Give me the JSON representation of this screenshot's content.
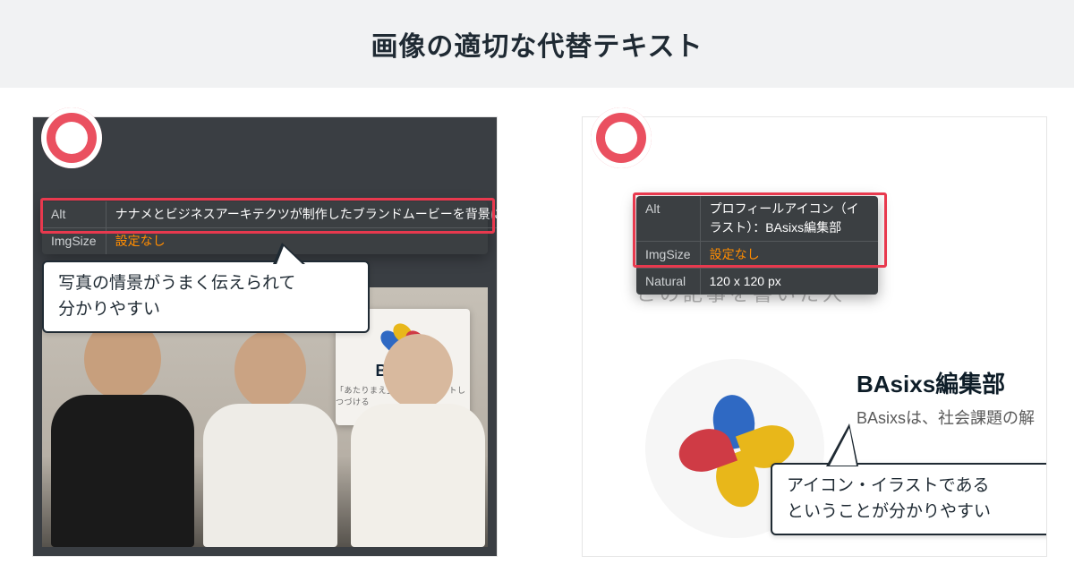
{
  "header": {
    "title": "画像の適切な代替テキスト"
  },
  "left": {
    "tooltip": {
      "alt_key": "Alt",
      "alt_value": "ナナメとビジネスアーキテクツが制作したブランドムービーを背景に集合",
      "size_key": "ImgSize",
      "size_value": "設定なし"
    },
    "callout": "写真の情景がうまく伝えられて\n分かりやすい",
    "sample": {
      "logo_name": "BAsixs",
      "logo_tagline": "「あたりまえ」を アップデートしつづける"
    }
  },
  "right": {
    "tooltip": {
      "alt_key": "Alt",
      "alt_value": "プロフィールアイコン（イラスト）：BAsixs編集部",
      "size_key": "ImgSize",
      "size_value": "設定なし",
      "nat_key": "Natural",
      "nat_value": "120 x 120 px"
    },
    "callout": "アイコン・イラストである\nということが分かりやすい",
    "sample": {
      "ghost_text": "この記事を書いた人",
      "profile_name": "BAsixs編集部",
      "profile_desc": "BAsixsは、社会課題の解"
    }
  }
}
